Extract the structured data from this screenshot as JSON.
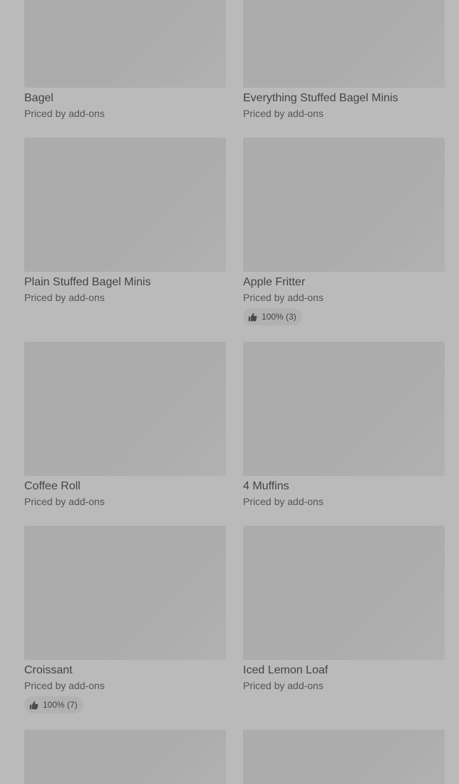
{
  "items": [
    {
      "title": "Bagel",
      "subtitle": "Priced by add-ons"
    },
    {
      "title": "Everything Stuffed Bagel Minis",
      "subtitle": "Priced by add-ons"
    },
    {
      "title": "Plain Stuffed Bagel Minis",
      "subtitle": "Priced by add-ons"
    },
    {
      "title": "Apple Fritter",
      "subtitle": "Priced by add-ons",
      "rating": "100% (3)"
    },
    {
      "title": "Coffee Roll",
      "subtitle": "Priced by add-ons"
    },
    {
      "title": "4 Muffins",
      "subtitle": "Priced by add-ons"
    },
    {
      "title": "Croissant",
      "subtitle": "Priced by add-ons",
      "rating": "100% (7)"
    },
    {
      "title": "Iced Lemon Loaf",
      "subtitle": "Priced by add-ons"
    }
  ],
  "icons": {
    "rating": "thumbs-up-icon"
  }
}
